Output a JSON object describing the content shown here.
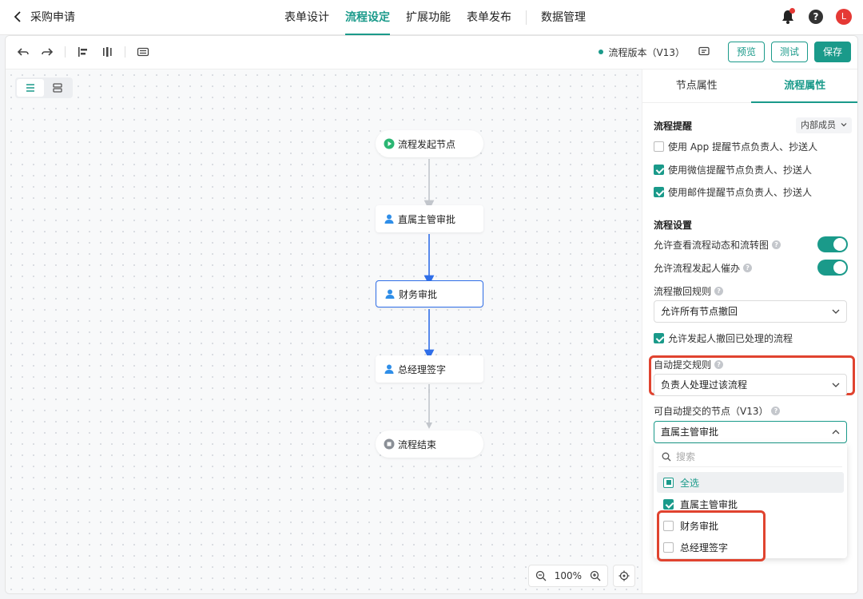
{
  "header": {
    "back_title": "采购申请",
    "tabs": [
      {
        "label": "表单设计",
        "active": false
      },
      {
        "label": "流程设定",
        "active": true
      },
      {
        "label": "扩展功能",
        "active": false
      },
      {
        "label": "表单发布",
        "active": false
      },
      {
        "label": "数据管理",
        "active": false
      }
    ],
    "help_glyph": "?",
    "avatar_letter": "L"
  },
  "toolbar": {
    "version_label": "流程版本（V13）",
    "preview_label": "预览",
    "test_label": "测试",
    "save_label": "保存"
  },
  "canvas": {
    "nodes": [
      {
        "label": "流程发起节点",
        "icon": "play-icon"
      },
      {
        "label": "直属主管审批",
        "icon": "user-icon"
      },
      {
        "label": "财务审批",
        "icon": "user-icon",
        "selected": true
      },
      {
        "label": "总经理签字",
        "icon": "user-icon"
      },
      {
        "label": "流程结束",
        "icon": "stop-icon"
      }
    ],
    "zoom": "100%"
  },
  "panel": {
    "tabs": [
      {
        "label": "节点属性",
        "active": false
      },
      {
        "label": "流程属性",
        "active": true
      }
    ],
    "reminder": {
      "title": "流程提醒",
      "scope": "内部成员",
      "options": [
        {
          "label": "使用 App 提醒节点负责人、抄送人",
          "checked": false
        },
        {
          "label": "使用微信提醒节点负责人、抄送人",
          "checked": true
        },
        {
          "label": "使用邮件提醒节点负责人、抄送人",
          "checked": true
        }
      ]
    },
    "settings": {
      "title": "流程设置",
      "allow_view_label": "允许查看流程动态和流转图",
      "allow_view_on": true,
      "allow_urge_label": "允许流程发起人催办",
      "allow_urge_on": true,
      "withdraw_rule_label": "流程撤回规则",
      "withdraw_rule_value": "允许所有节点撤回",
      "allow_withdraw_label": "允许发起人撤回已处理的流程",
      "allow_withdraw_checked": true,
      "auto_submit_label": "自动提交规则",
      "auto_submit_value": "负责人处理过该流程",
      "auto_nodes_label": "可自动提交的节点（V13）",
      "auto_nodes_value": "直属主管审批"
    },
    "dropdown": {
      "search_placeholder": "搜索",
      "select_all_label": "全选",
      "items": [
        {
          "label": "直属主管审批",
          "checked": true
        },
        {
          "label": "财务审批",
          "checked": false
        },
        {
          "label": "总经理签字",
          "checked": false
        }
      ]
    }
  },
  "colors": {
    "accent": "#1a9a8a",
    "selected_node_border": "#2f6ee8",
    "highlight_box": "#e0432f"
  }
}
